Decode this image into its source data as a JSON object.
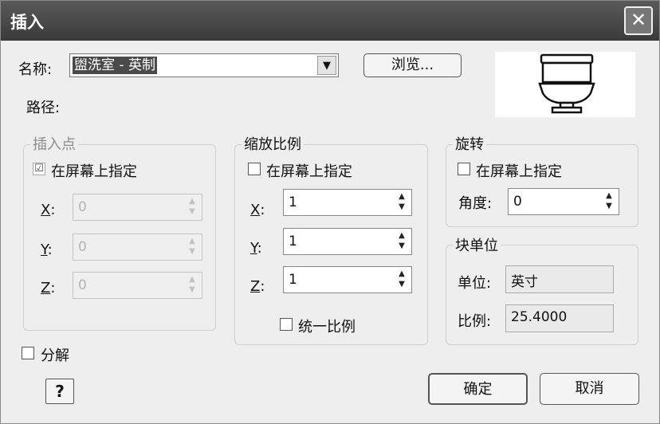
{
  "title": "插入",
  "close_glyph": "✕",
  "name_label": "名称:",
  "name_value": "盥洗室 - 英制",
  "browse_label": "浏览...",
  "path_label": "路径:",
  "insertion": {
    "title": "插入点",
    "specify_label": "在屏幕上指定",
    "specify_checked": true,
    "x_letter": "X",
    "y_letter": "Y",
    "z_letter": "Z",
    "colon": ":",
    "x": "0",
    "y": "0",
    "z": "0"
  },
  "scale": {
    "title": "缩放比例",
    "specify_label": "在屏幕上指定",
    "specify_checked": false,
    "x_letter": "X",
    "y_letter": "Y",
    "z_letter": "Z",
    "colon": ":",
    "x": "1",
    "y": "1",
    "z": "1",
    "uniform_label": "统一比例",
    "uniform_checked": false
  },
  "rotation": {
    "title": "旋转",
    "specify_label": "在屏幕上指定",
    "specify_checked": false,
    "angle_label": "角度:",
    "angle": "0"
  },
  "block_unit": {
    "title": "块单位",
    "unit_label": "单位:",
    "unit_value": "英寸",
    "factor_label": "比例:",
    "factor_value": "25.4000"
  },
  "explode_label": "分解",
  "explode_checked": false,
  "help_label": "?",
  "ok_label": "确定",
  "cancel_label": "取消",
  "icons": {
    "check": "☑",
    "spin_up": "▲",
    "spin_down": "▼",
    "dropdown": "▼"
  }
}
